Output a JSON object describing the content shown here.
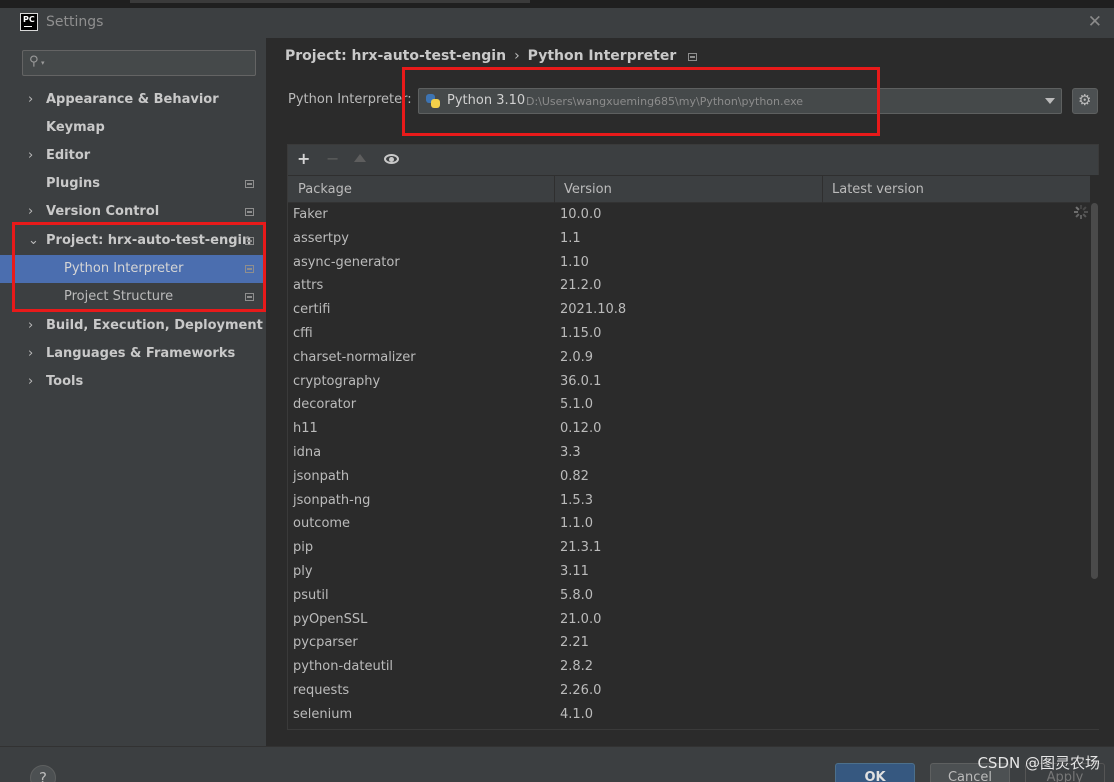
{
  "window": {
    "title": "Settings",
    "app_icon": "PC"
  },
  "search": {
    "placeholder": "",
    "value": ""
  },
  "sidebar": {
    "items": [
      {
        "label": "Appearance & Behavior",
        "chevron": "›"
      },
      {
        "label": "Keymap"
      },
      {
        "label": "Editor",
        "chevron": "›"
      },
      {
        "label": "Plugins"
      },
      {
        "label": "Version Control",
        "chevron": "›"
      },
      {
        "label": "Project: hrx-auto-test-engin",
        "chevron": "⌄"
      },
      {
        "label": "Python Interpreter"
      },
      {
        "label": "Project Structure"
      },
      {
        "label": "Build, Execution, Deployment",
        "chevron": "›"
      },
      {
        "label": "Languages & Frameworks",
        "chevron": "›"
      },
      {
        "label": "Tools",
        "chevron": "›"
      }
    ]
  },
  "breadcrumb": {
    "project": "Project: hrx-auto-test-engin",
    "separator": "›",
    "page": "Python Interpreter"
  },
  "interpreter": {
    "label": "Python Interpreter:",
    "name": "Python 3.10",
    "path": "D:\\Users\\wangxueming685\\my\\Python\\python.exe"
  },
  "toolbar": {
    "add": "+",
    "remove": "−"
  },
  "packages": {
    "columns": [
      "Package",
      "Version",
      "Latest version"
    ],
    "rows": [
      {
        "name": "Faker",
        "version": "10.0.0",
        "latest": ""
      },
      {
        "name": "assertpy",
        "version": "1.1",
        "latest": ""
      },
      {
        "name": "async-generator",
        "version": "1.10",
        "latest": ""
      },
      {
        "name": "attrs",
        "version": "21.2.0",
        "latest": ""
      },
      {
        "name": "certifi",
        "version": "2021.10.8",
        "latest": ""
      },
      {
        "name": "cffi",
        "version": "1.15.0",
        "latest": ""
      },
      {
        "name": "charset-normalizer",
        "version": "2.0.9",
        "latest": ""
      },
      {
        "name": "cryptography",
        "version": "36.0.1",
        "latest": ""
      },
      {
        "name": "decorator",
        "version": "5.1.0",
        "latest": ""
      },
      {
        "name": "h11",
        "version": "0.12.0",
        "latest": ""
      },
      {
        "name": "idna",
        "version": "3.3",
        "latest": ""
      },
      {
        "name": "jsonpath",
        "version": "0.82",
        "latest": ""
      },
      {
        "name": "jsonpath-ng",
        "version": "1.5.3",
        "latest": ""
      },
      {
        "name": "outcome",
        "version": "1.1.0",
        "latest": ""
      },
      {
        "name": "pip",
        "version": "21.3.1",
        "latest": ""
      },
      {
        "name": "ply",
        "version": "3.11",
        "latest": ""
      },
      {
        "name": "psutil",
        "version": "5.8.0",
        "latest": ""
      },
      {
        "name": "pyOpenSSL",
        "version": "21.0.0",
        "latest": ""
      },
      {
        "name": "pycparser",
        "version": "2.21",
        "latest": ""
      },
      {
        "name": "python-dateutil",
        "version": "2.8.2",
        "latest": ""
      },
      {
        "name": "requests",
        "version": "2.26.0",
        "latest": ""
      },
      {
        "name": "selenium",
        "version": "4.1.0",
        "latest": ""
      }
    ]
  },
  "buttons": {
    "help": "?",
    "ok": "OK",
    "cancel": "Cancel",
    "apply": "Apply"
  },
  "watermark": "CSDN @图灵农场",
  "colors": {
    "selection": "#4b6eaf",
    "highlight_box": "#e81a1a",
    "ok_button": "#365880"
  }
}
